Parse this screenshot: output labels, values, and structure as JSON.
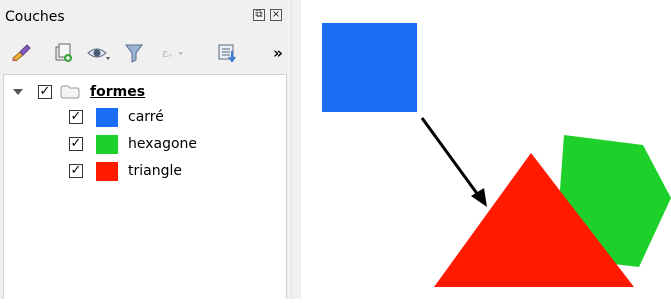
{
  "panel": {
    "title": "Couches",
    "float_glyph": "⧉",
    "close_glyph": "×",
    "more_glyph": "»"
  },
  "toolbar": {
    "icons": [
      "style-brush-icon",
      "add-group-icon",
      "visibility-eye-icon",
      "filter-funnel-icon",
      "expression-filter-icon",
      "expand-collapse-icon"
    ]
  },
  "tree": {
    "group": {
      "label": "formes",
      "checked": true,
      "expanded": true
    },
    "layers": [
      {
        "label": "carré",
        "color": "#1a6ef5",
        "checked": true
      },
      {
        "label": "hexagone",
        "color": "#1ed12a",
        "checked": true
      },
      {
        "label": "triangle",
        "color": "#ff1a00",
        "checked": true
      }
    ],
    "check_glyph": "✓"
  },
  "map": {
    "colors": {
      "square": "#1a6ef5",
      "hexagon": "#1ed12a",
      "triangle": "#ff1a00",
      "arrow": "#000000"
    }
  }
}
